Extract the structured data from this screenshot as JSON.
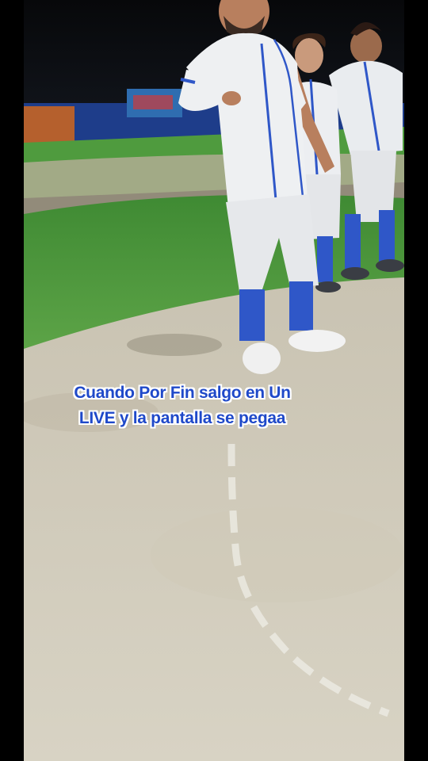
{
  "caption": {
    "line1": "Cuando Por Fin salgo en Un",
    "line2": "LIVE y la pantalla se pegaa"
  },
  "colors": {
    "caption_text": "#1f49c9",
    "caption_outline": "#ffffff",
    "jersey": "#eef0f2",
    "jersey_trim": "#2f57c8",
    "socks": "#2f57c8",
    "grass": "#4d9a3c",
    "dirt": "#d9d4c5",
    "night_sky": "#0b0d10"
  },
  "scene": {
    "description_icons": [
      "player-center-figure",
      "player-left-figure",
      "player-right-figure",
      "outfield-wall",
      "scoreboard-sign"
    ]
  }
}
